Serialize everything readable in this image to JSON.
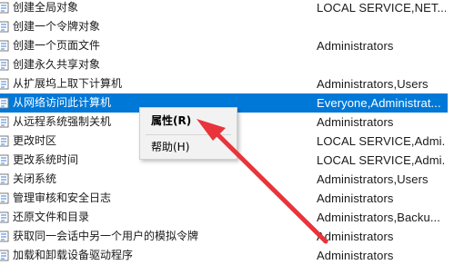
{
  "policies": [
    {
      "name": "创建全局对象",
      "setting": "LOCAL SERVICE,NET..."
    },
    {
      "name": "创建一个令牌对象",
      "setting": ""
    },
    {
      "name": "创建一个页面文件",
      "setting": "Administrators"
    },
    {
      "name": "创建永久共享对象",
      "setting": ""
    },
    {
      "name": "从扩展坞上取下计算机",
      "setting": "Administrators,Users"
    },
    {
      "name": "从网络访问此计算机",
      "setting": "Everyone,Administrat..."
    },
    {
      "name": "从远程系统强制关机",
      "setting": "Administrators"
    },
    {
      "name": "更改时区",
      "setting": "LOCAL SERVICE,Admi..."
    },
    {
      "name": "更改系统时间",
      "setting": "LOCAL SERVICE,Admi..."
    },
    {
      "name": "关闭系统",
      "setting": "Administrators,Users"
    },
    {
      "name": "管理审核和安全日志",
      "setting": "Administrators"
    },
    {
      "name": "还原文件和目录",
      "setting": "Administrators,Backu..."
    },
    {
      "name": "获取同一会话中另一个用户的模拟令牌",
      "setting": "Administrators"
    },
    {
      "name": "加载和卸载设备驱动程序",
      "setting": "Administrators"
    }
  ],
  "selected_index": 5,
  "context_menu": {
    "items": [
      {
        "label": "属性(R)",
        "bold": true
      },
      {
        "label": "帮助(H)",
        "bold": false
      }
    ]
  },
  "colors": {
    "selection": "#0078d7",
    "arrow": "#e8343a"
  },
  "icons": {
    "policy": "policy-icon"
  }
}
